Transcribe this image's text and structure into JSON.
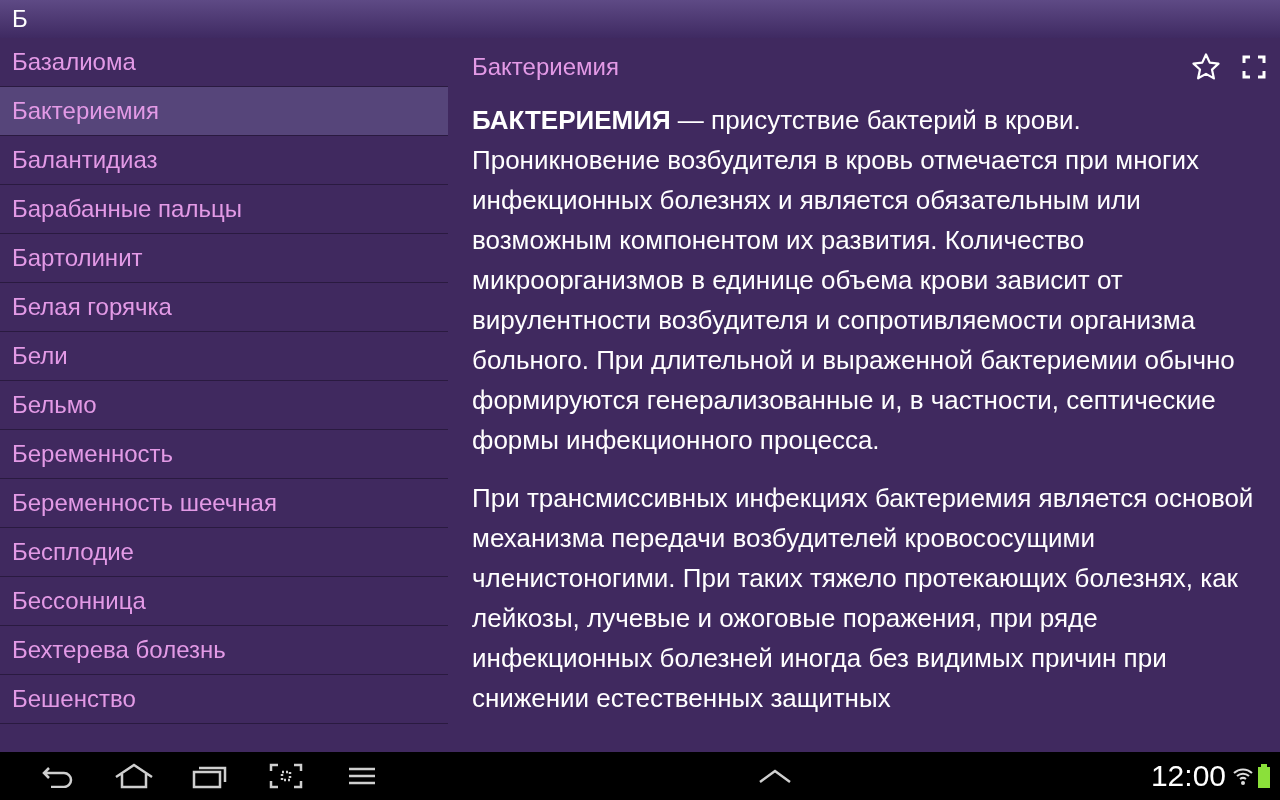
{
  "header": {
    "letter": "Б"
  },
  "list": [
    {
      "label": "Базалиома",
      "selected": false
    },
    {
      "label": "Бактериемия",
      "selected": true
    },
    {
      "label": "Балантидиаз",
      "selected": false
    },
    {
      "label": "Барабанные пальцы",
      "selected": false
    },
    {
      "label": "Бартолинит",
      "selected": false
    },
    {
      "label": "Белая горячка",
      "selected": false
    },
    {
      "label": "Бели",
      "selected": false
    },
    {
      "label": "Бельмо",
      "selected": false
    },
    {
      "label": "Беременность",
      "selected": false
    },
    {
      "label": "Беременность шеечная",
      "selected": false
    },
    {
      "label": "Бесплодие",
      "selected": false
    },
    {
      "label": "Бессонница",
      "selected": false
    },
    {
      "label": "Бехтерева болезнь",
      "selected": false
    },
    {
      "label": "Бешенство",
      "selected": false
    }
  ],
  "article": {
    "title": "Бактериемия",
    "favorite": false,
    "paragraphs": [
      "**БАКТЕРИЕМИЯ** — присутствие бактерий в крови. Проникновение возбудителя в кровь отмечается при многих инфекционных болезнях и является обязательным или возможным компонентом их развития. Количество микроорганизмов в единице объема крови зависит от вирулентности возбудителя и сопротивляемости организма больного. При длительной и выраженной бактериемии обычно формируются генерализованные и, в частности, септические формы инфекционного процесса.",
      "При трансмиссивных инфекциях бактериемия является основой механизма передачи возбудителей кровососущими членистоногими. При таких тяжело протекающих болезнях, как лейкозы, лучевые и ожоговые поражения, при ряде инфекционных болезней иногда без видимых причин при снижении естественных защитных"
    ]
  },
  "nav_bar": {
    "time": "12:00"
  }
}
